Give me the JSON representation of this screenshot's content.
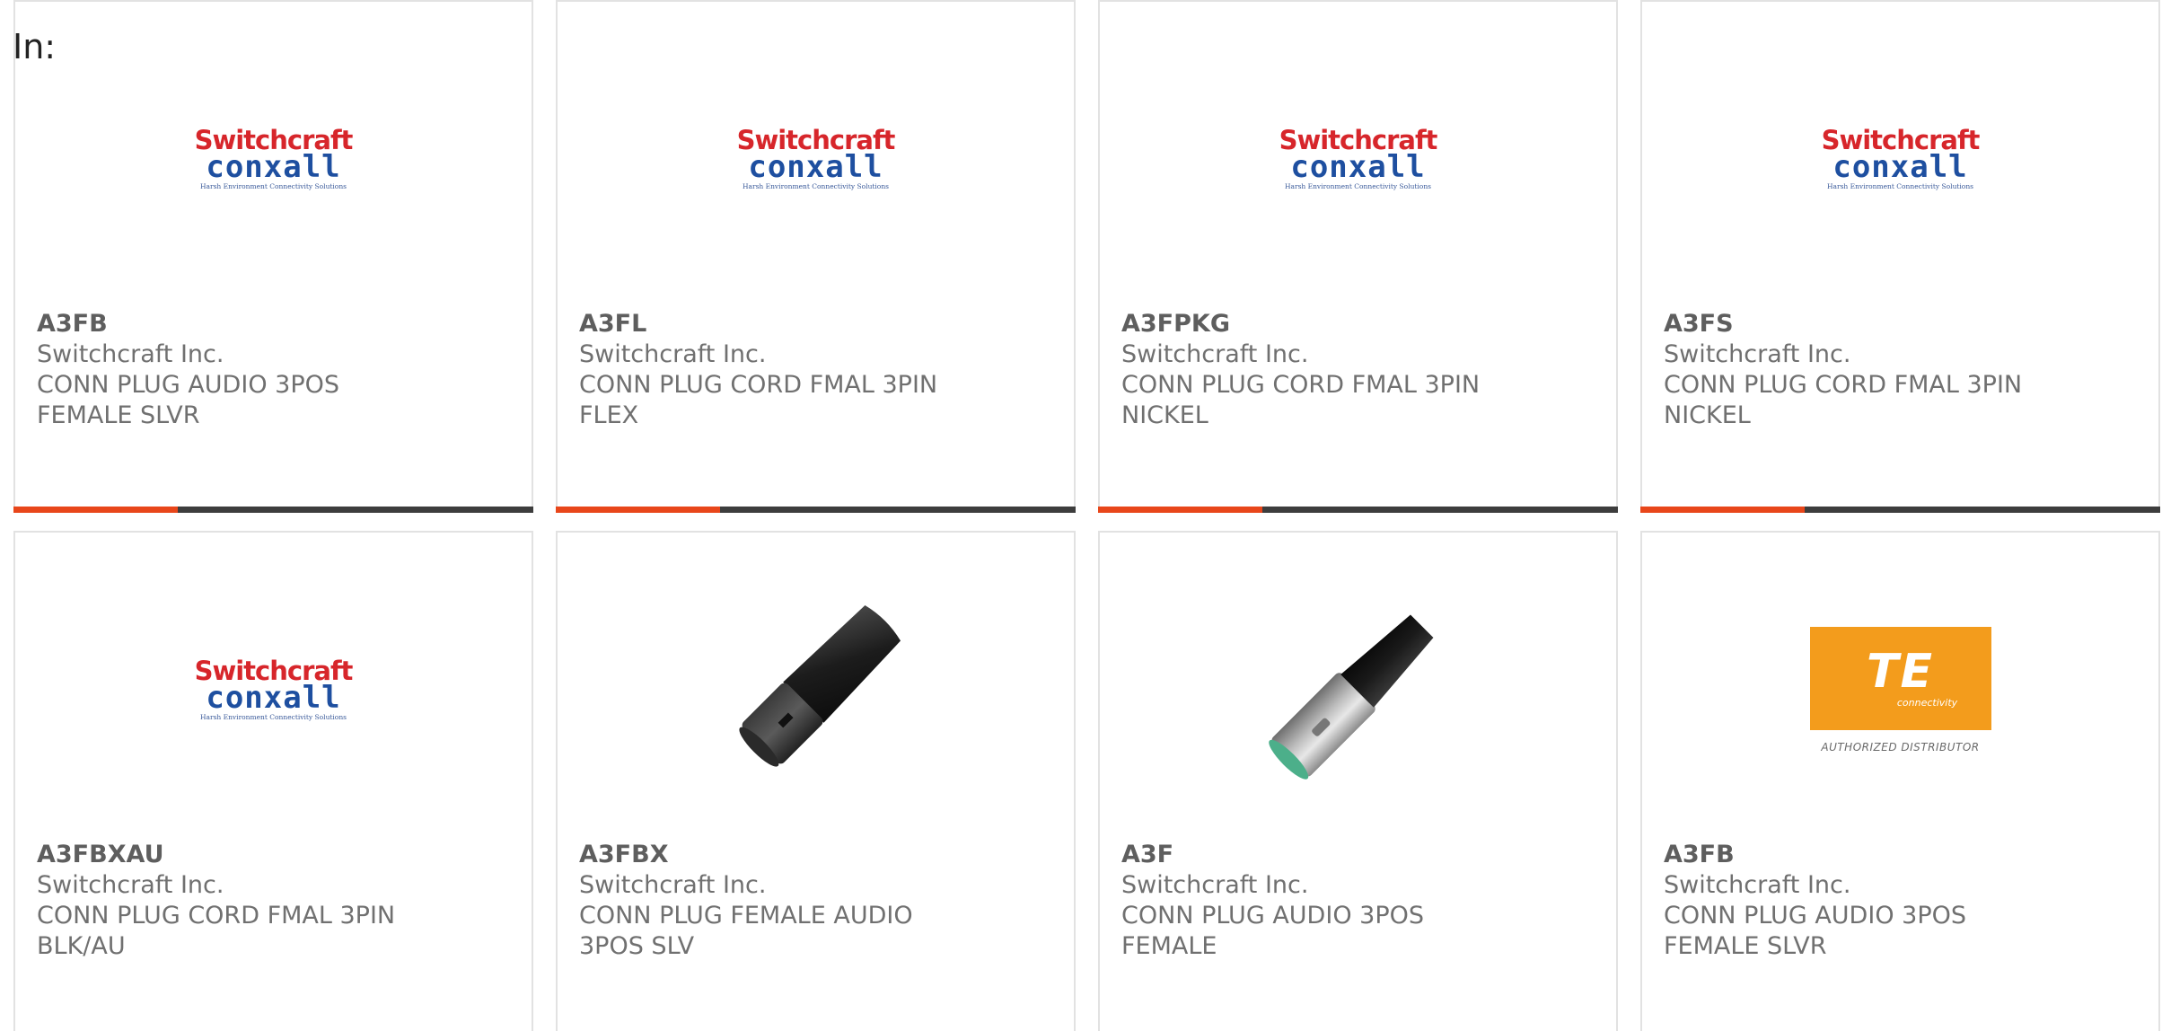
{
  "header": {
    "label": "In:"
  },
  "products": [
    {
      "part": "A3FB",
      "manufacturer": "Switchcraft Inc.",
      "desc_line1": "CONN PLUG AUDIO 3POS",
      "desc_line2": "FEMALE SLVR",
      "image": "switchcraft-conxall-logo"
    },
    {
      "part": "A3FL",
      "manufacturer": "Switchcraft Inc.",
      "desc_line1": "CONN PLUG CORD FMAL 3PIN",
      "desc_line2": "FLEX",
      "image": "switchcraft-conxall-logo"
    },
    {
      "part": "A3FPKG",
      "manufacturer": "Switchcraft Inc.",
      "desc_line1": "CONN PLUG CORD FMAL 3PIN",
      "desc_line2": "NICKEL",
      "image": "switchcraft-conxall-logo"
    },
    {
      "part": "A3FS",
      "manufacturer": "Switchcraft Inc.",
      "desc_line1": "CONN PLUG CORD FMAL 3PIN",
      "desc_line2": "NICKEL",
      "image": "switchcraft-conxall-logo"
    },
    {
      "part": "A3FBXAU",
      "manufacturer": "Switchcraft Inc.",
      "desc_line1": "CONN PLUG CORD FMAL 3PIN",
      "desc_line2": "BLK/AU",
      "image": "switchcraft-conxall-logo"
    },
    {
      "part": "A3FBX",
      "manufacturer": "Switchcraft Inc.",
      "desc_line1": "CONN PLUG FEMALE AUDIO",
      "desc_line2": "3POS SLV",
      "image": "black-xlr-connector-photo"
    },
    {
      "part": "A3F",
      "manufacturer": "Switchcraft Inc.",
      "desc_line1": "CONN PLUG AUDIO 3POS",
      "desc_line2": "FEMALE",
      "image": "silver-xlr-connector-photo"
    },
    {
      "part": "A3FB",
      "manufacturer": "Switchcraft Inc.",
      "desc_line1": "CONN PLUG AUDIO 3POS",
      "desc_line2": "FEMALE SLVR",
      "image": "te-connectivity-logo"
    }
  ],
  "logos": {
    "switchcraft": {
      "line1": "Switchcraft",
      "line2": "conxall",
      "line3": "Harsh Environment Connectivity Solutions"
    },
    "te": {
      "mark": "TE",
      "sub": "connectivity",
      "caption": "AUTHORIZED DISTRIBUTOR"
    }
  },
  "colors": {
    "accent": "#e8461a",
    "bar": "#3d3d3d",
    "text": "#707070",
    "border": "#e2e2e2",
    "te_orange": "#f39c1c"
  }
}
